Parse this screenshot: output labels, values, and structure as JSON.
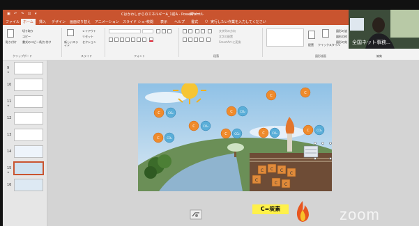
{
  "titlebar": {
    "doc_title": "CはかわしからのエネルギーA_1前A - PowerPoint",
    "tools_label": "図ツール"
  },
  "tabs": [
    "ファイル",
    "ホーム",
    "挿入",
    "デザイン",
    "画面切り替え",
    "アニメーション",
    "スライド ショー",
    "校閲",
    "表示",
    "ヘルプ",
    "書式"
  ],
  "active_tab": "ホーム",
  "tell_me": "実行したい作業を入力してください",
  "ribbon": {
    "paste": "貼り付け",
    "cut": "切り取り",
    "copy": "コピー",
    "format_painter": "書式のコピー/貼り付け",
    "clipboard_group": "クリップボード",
    "new_slide": "新しいスライド",
    "layout": "レイアウト",
    "reset": "リセット",
    "section": "セクション",
    "slides_group": "スライド",
    "font_group": "フォント",
    "paragraph_group": "段落",
    "text_direction": "文字列の方向",
    "align_text": "文字の配置",
    "smartart": "SmartArt に変換",
    "arrange": "配置",
    "quick_styles": "クイックスタイル",
    "shape_fill": "図形の塗",
    "shape_outline": "図形の枠",
    "shape_effects": "図形の効",
    "drawing_group": "図形描画",
    "editing_group": "編集"
  },
  "slides": [
    {
      "num": "9",
      "star": "★"
    },
    {
      "num": "10",
      "star": ""
    },
    {
      "num": "11",
      "star": "★"
    },
    {
      "num": "12",
      "star": ""
    },
    {
      "num": "13",
      "star": ""
    },
    {
      "num": "14",
      "star": ""
    },
    {
      "num": "15",
      "star": "★"
    },
    {
      "num": "16",
      "star": ""
    }
  ],
  "selected_slide": "15",
  "webcam": {
    "name": "全国ネット事務..."
  },
  "slide_bubbles": {
    "c": "C",
    "co2": "CO₂"
  },
  "overlay": {
    "carbon_label": "C=炭素",
    "watermark": "zoom"
  },
  "colors": {
    "accent": "#c9542f",
    "ribbon_bg": "#f3f3f3",
    "canvas_bg": "#d4d4d4",
    "label_bg": "#fff14a"
  }
}
